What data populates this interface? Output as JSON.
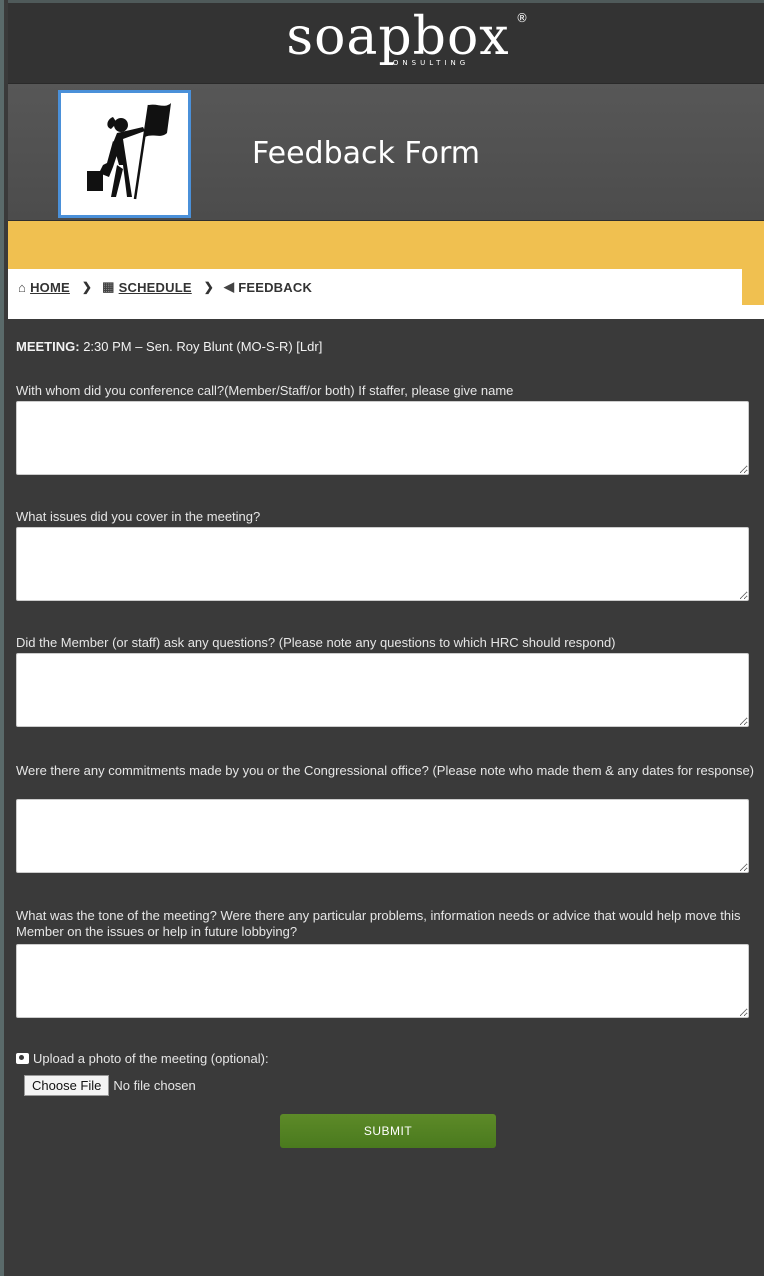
{
  "header": {
    "logo_word": "soapbox",
    "logo_sub": "CONSULTING",
    "logo_reg": "®"
  },
  "title_band": {
    "title": "Feedback Form"
  },
  "breadcrumb": {
    "home": "HOME",
    "schedule": "SCHEDULE",
    "feedback": "FEEDBACK"
  },
  "meeting": {
    "label": "MEETING:",
    "value": "2:30 PM – Sen. Roy Blunt (MO-S-R) [Ldr]"
  },
  "questions": [
    "With whom did you conference call?(Member/Staff/or both) If staffer, please give name",
    "What issues did you cover in the meeting?",
    "Did the Member (or staff) ask any questions? (Please note any questions to which HRC should respond)",
    "Were there any commitments made by you or the Congressional office? (Please note who made them & any dates for response)",
    "What was the tone of the meeting? Were there any particular problems, information needs or advice that would help move this Member on the issues or help in future lobbying?"
  ],
  "upload": {
    "label": "Upload a photo of the meeting (optional):",
    "button": "Choose File",
    "status": "No file chosen"
  },
  "submit_label": "SUBMIT",
  "colors": {
    "accent_yellow": "#f0c050",
    "submit_green": "#5d8a28",
    "background": "#3a3a3a"
  }
}
